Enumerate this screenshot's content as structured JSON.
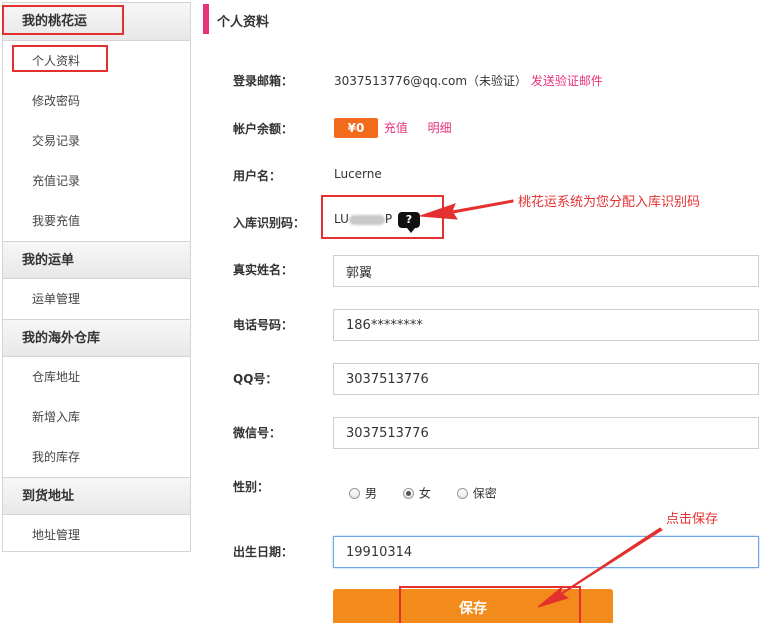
{
  "sidebar": {
    "groups": [
      {
        "title": "我的桃花运",
        "items": [
          "个人资料",
          "修改密码",
          "交易记录",
          "充值记录",
          "我要充值"
        ]
      },
      {
        "title": "我的运单",
        "items": [
          "运单管理"
        ]
      },
      {
        "title": "我的海外仓库",
        "items": [
          "仓库地址",
          "新增入库",
          "我的库存"
        ]
      },
      {
        "title": "到货地址",
        "items": [
          "地址管理"
        ]
      }
    ]
  },
  "main": {
    "title": "个人资料",
    "email": {
      "label": "登录邮箱：",
      "value": "3037513776@qq.com（未验证）",
      "action": "发送验证邮件"
    },
    "balance": {
      "label": "帐户余额：",
      "amount": "¥0",
      "recharge": "充值",
      "detail": "明细"
    },
    "username": {
      "label": "用户名：",
      "value": "Lucerne"
    },
    "warehouse_code": {
      "label": "入库识别码：",
      "value_prefix": "LU",
      "value_suffix": "P",
      "help_icon": "question-bubble-icon"
    },
    "real_name": {
      "label": "真实姓名：",
      "value": "郭翼"
    },
    "phone": {
      "label": "电话号码：",
      "value": "186********"
    },
    "qq": {
      "label": "QQ号：",
      "value": "3037513776"
    },
    "wechat": {
      "label": "微信号：",
      "value": "3037513776"
    },
    "gender": {
      "label": "性别：",
      "options": [
        "男",
        "女",
        "保密"
      ],
      "selected": "女"
    },
    "birthday": {
      "label": "出生日期：",
      "value": "19910314"
    },
    "save_label": "保存"
  },
  "annotations": {
    "code_note": "桃花运系统为您分配入库识别码",
    "save_note": "点击保存",
    "color": "#e53030"
  },
  "colors": {
    "accent": "#e8327c",
    "button": "#f28a1c",
    "badge": "#f26b1d"
  }
}
